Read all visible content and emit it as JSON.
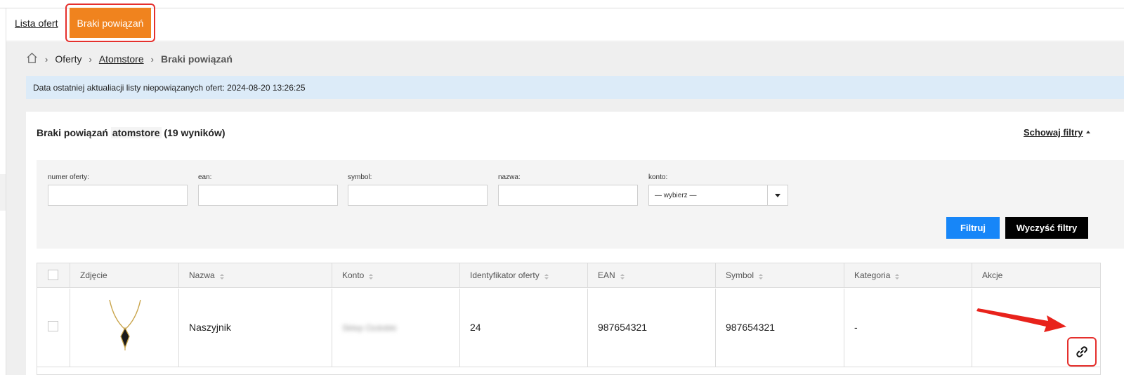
{
  "tabs": {
    "list_label": "Lista ofert",
    "active_label": "Braki powiązań"
  },
  "breadcrumb": {
    "home_icon": "home-icon",
    "items": [
      "Oferty",
      "Atomstore",
      "Braki powiązań"
    ]
  },
  "info": {
    "text": "Data ostatniej aktualiacji listy niepowiązanych ofert: 2024-08-20 13:26:25"
  },
  "panel": {
    "title_main": "Braki powiązań",
    "title_store": "atomstore",
    "title_count": "(19 wyników)",
    "hide_filters_label": "Schowaj filtry"
  },
  "filters": {
    "offer_number_label": "numer oferty:",
    "ean_label": "ean:",
    "symbol_label": "symbol:",
    "name_label": "nazwa:",
    "account_label": "konto:",
    "account_value": "— wybierz —",
    "filter_button": "Filtruj",
    "clear_button": "Wyczyść filtry"
  },
  "table": {
    "headers": {
      "image": "Zdjęcie",
      "name": "Nazwa",
      "account": "Konto",
      "offer_id": "Identyfikator oferty",
      "ean": "EAN",
      "symbol": "Symbol",
      "category": "Kategoria",
      "actions": "Akcje"
    },
    "rows": [
      {
        "name": "Naszyjnik",
        "account": "Sklep Ozdobki",
        "offer_id": "24",
        "ean": "987654321",
        "symbol": "987654321",
        "category": "-",
        "action_icon": "link-icon"
      }
    ]
  },
  "colors": {
    "active_tab": "#f0831e",
    "highlight": "#e5302d",
    "filter_button": "#1786f8",
    "info_bg": "#dcebf8"
  }
}
